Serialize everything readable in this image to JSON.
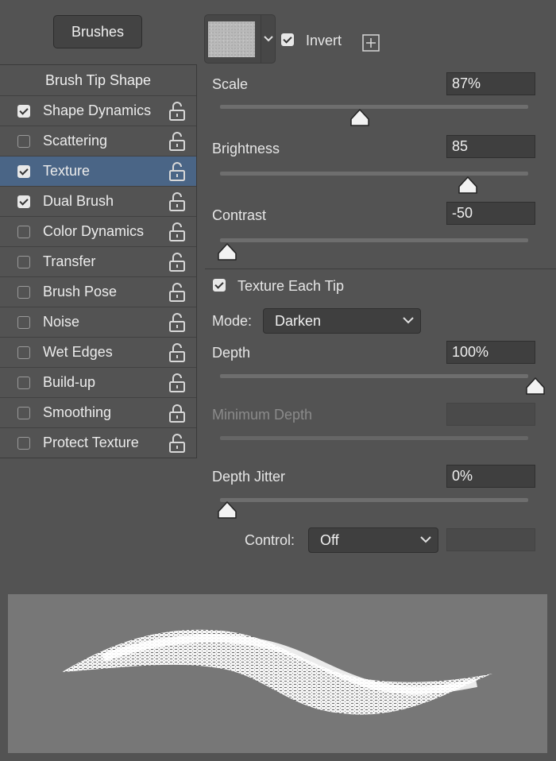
{
  "brushes_button": "Brushes",
  "sidebar": {
    "header": "Brush Tip Shape",
    "items": [
      {
        "label": "Shape Dynamics",
        "checked": true,
        "selected": false
      },
      {
        "label": "Scattering",
        "checked": false,
        "selected": false
      },
      {
        "label": "Texture",
        "checked": true,
        "selected": true
      },
      {
        "label": "Dual Brush",
        "checked": true,
        "selected": false
      },
      {
        "label": "Color Dynamics",
        "checked": false,
        "selected": false
      },
      {
        "label": "Transfer",
        "checked": false,
        "selected": false
      },
      {
        "label": "Brush Pose",
        "checked": false,
        "selected": false
      },
      {
        "label": "Noise",
        "checked": false,
        "selected": false
      },
      {
        "label": "Wet Edges",
        "checked": false,
        "selected": false
      },
      {
        "label": "Build-up",
        "checked": false,
        "selected": false
      },
      {
        "label": "Smoothing",
        "checked": false,
        "selected": false
      },
      {
        "label": "Protect Texture",
        "checked": false,
        "selected": false
      }
    ]
  },
  "texture": {
    "invert_label": "Invert",
    "invert_checked": true,
    "scale": {
      "label": "Scale",
      "value": "87%",
      "level": 0.43
    },
    "brightness": {
      "label": "Brightness",
      "value": "85",
      "level": 0.78
    },
    "contrast": {
      "label": "Contrast",
      "value": "-50",
      "level": 0.0
    },
    "each_tip_label": "Texture Each Tip",
    "each_tip_checked": true,
    "mode_label": "Mode:",
    "mode_value": "Darken",
    "depth": {
      "label": "Depth",
      "value": "100%",
      "level": 1.0
    },
    "min_depth": {
      "label": "Minimum Depth",
      "value": ""
    },
    "depth_jitter": {
      "label": "Depth Jitter",
      "value": "0%",
      "level": 0.0
    },
    "control_label": "Control:",
    "control_value": "Off",
    "control_extra": ""
  },
  "colors": {
    "selected_row": "#4a6586",
    "panel": "#535353",
    "preview_bg": "#777777"
  },
  "icons": [
    "checkbox-icon",
    "lock-open-icon",
    "lock-closed-icon",
    "chevron-down-icon",
    "new-preset-plus-icon",
    "slider-thumb-icon"
  ]
}
